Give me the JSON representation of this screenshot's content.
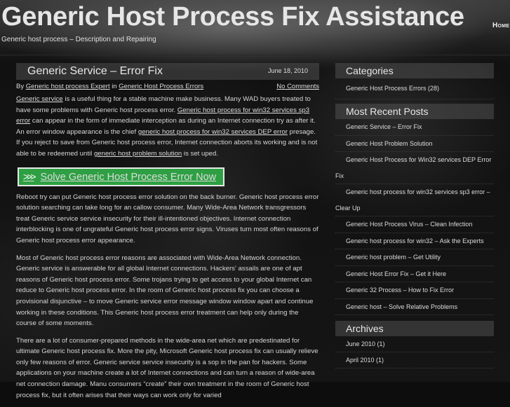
{
  "header": {
    "site_title": "Generic Host Process Fix Assistance",
    "site_description": "Generic host process – Description and Repairing",
    "nav_home": "Home"
  },
  "post": {
    "title": "Generic Service – Error Fix",
    "date": "June 18, 2010",
    "meta": {
      "by_label": "By",
      "author": "Generic host process Expert",
      "in_label": "in",
      "category": "Generic Host Process Errors",
      "comments": "No Comments"
    },
    "p1": {
      "link1": "Generic service",
      "t1": " is a useful thing for a stable machine make business. Many WAD buyers treated to have some problems with Generic host process error. ",
      "link2": "Generic host process for win32 services sp3 error",
      "t2": " can appear in the form of immediate interception as during an Internet connection try as after it. An error window appearance is the chief ",
      "link3": "generic host process for win32 services DEP error",
      "t3": " presage. If you reject to save from Generic host process error, Internet connection aborts its working and is not able to be redeemed until ",
      "link4": "generic host problem solution",
      "t4": " is set uped."
    },
    "cta_label": "Solve Generic Host Process Error Now",
    "p2": "Reboot try can put Generic host process error solution on the back burner. Generic host process error solution searching can take long for an callow consumer. Many Wide-Area Network transgressors treat Generic service service insecurity for their ill-intentioned objectives. Internet connection interblocking is one of ungrateful Generic host process error signs. Viruses turn most often reasons of Generic host process error appearance.",
    "p3": "Most of Generic host process error reasons are associated with Wide-Area Network connection. Generic service is answerable for all global Internet connections. Hackers' assails are one of apt reasons of Generic host process error. Some trojans trying to get access to your global Internet can reduce to Generic host process error. In the room of Generic host process fix you can choose a provisional disjunctive – to move Generic service error message window window apart and continue working in these conditions. This Generic host process error treatment can help only during the course of some moments.",
    "p4": "There are a lot of consumer-prepared methods in the wide-area net which are predestinated for ultimate Generic host process fix. More the pity, Microsoft Generic host process fix can usually relieve only few reasons of error. Generic service service insecurity is a sop in the pan for hackers. Some applications on your machine create a lot of Internet connections and can turn a reason of wide-area net connection damage. Manu consumers “create” their own treatment in the room of Generic host process fix, but it often arises that their ways can work only for varied"
  },
  "sidebar": {
    "categories": {
      "title": "Categories",
      "items": [
        "Generic Host Process Errors (28)"
      ]
    },
    "recent": {
      "title": "Most Recent Posts",
      "items": [
        {
          "line1": "Generic Service – Error Fix"
        },
        {
          "line1": "Generic Host Problem Solution"
        },
        {
          "line1": "Generic Host Process for Win32 services DEP Error",
          "line2": "Fix"
        },
        {
          "line1": "Generic host process for win32 services sp3 error –",
          "line2": "Clear Up"
        },
        {
          "line1": "Generic Host Process Virus – Clean Infection"
        },
        {
          "line1": "Generic host process for win32 – Ask the Experts"
        },
        {
          "line1": "Generic host problem – Get Utility"
        },
        {
          "line1": "Generic Host Error Fix – Get it Here"
        },
        {
          "line1": "Generic 32 Process – How to Fix Error"
        },
        {
          "line1": "Generic host – Solve Relative Problems"
        }
      ]
    },
    "archives": {
      "title": "Archives",
      "items": [
        "June 2010 (1)",
        "April 2010 (1)"
      ]
    }
  },
  "colors": {
    "cta_green": "#2ea043",
    "text": "#d6d6d6",
    "widget_header_bg": "#3c3c3c"
  }
}
